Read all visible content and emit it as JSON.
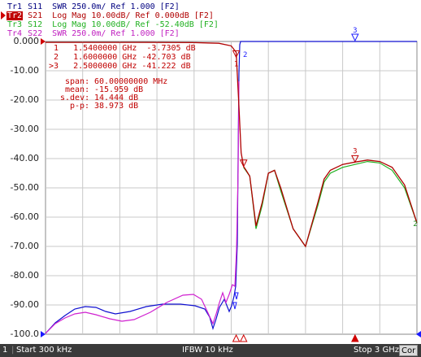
{
  "traces": [
    {
      "name": "Tr1",
      "text": " S11  SWR 250.0m/ Ref 1.000 [F2]",
      "color": "#000080",
      "active": false
    },
    {
      "name": "Tr2",
      "text": " S21  Log Mag 10.00dB/ Ref 0.000dB [F2]",
      "color": "#b00000",
      "active": true
    },
    {
      "name": "Tr3",
      "text": " S12  Log Mag 10.00dB/ Ref -52.40dB [F2]",
      "color": "#20b020",
      "active": false
    },
    {
      "name": "Tr4",
      "text": " S22  SWR 250.0m/ Ref 1.000 [F2]",
      "color": "#c020c0",
      "active": false
    }
  ],
  "y_axis_labels": [
    "0.000",
    "-10.00",
    "-20.00",
    "-30.00",
    "-40.00",
    "-50.00",
    "-60.00",
    "-70.00",
    "-80.00",
    "-90.00",
    "-100.0"
  ],
  "markers": [
    {
      "label": " 1   1.5400000 GHz  -3.7305 dB"
    },
    {
      "label": " 2   1.6000000 GHz -42.703 dB"
    },
    {
      "label": ">3   2.5000000 GHz -41.222 dB"
    }
  ],
  "stats": [
    {
      "label": "span:",
      "value": "60.00000000 MHz"
    },
    {
      "label": "mean:",
      "value": "-15.959 dB"
    },
    {
      "label": "s.dev:",
      "value": "14.444 dB"
    },
    {
      "label": "p-p:",
      "value": "38.973 dB"
    }
  ],
  "marker_tags": {
    "m1": "1",
    "m2": "2",
    "m3": "3",
    "top_m3": "3",
    "right_ref": "2"
  },
  "status": {
    "channel": "1",
    "start": "Start 300 kHz",
    "ifbw": "IFBW 10 kHz",
    "stop": "Stop 3 GHz",
    "cor": "Cor"
  },
  "colors": {
    "s21": "#b00000",
    "s12": "#20b020",
    "s11": "#1010d0",
    "s22": "#d020d0",
    "grid": "#c8c8c8",
    "marker": "#c00000"
  },
  "chart_data": {
    "type": "line",
    "xlabel": "",
    "ylabel": "",
    "x_range": [
      "300 kHz",
      "3 GHz"
    ],
    "x_unit": "GHz",
    "ylim": [
      -100,
      0
    ],
    "grid": true,
    "series": [
      {
        "name": "S21",
        "x": [
          0.0003,
          0.3,
          0.8,
          1.2,
          1.4,
          1.5,
          1.54,
          1.56,
          1.58,
          1.6,
          1.62,
          1.65,
          1.7,
          1.75,
          1.8,
          1.85,
          1.9,
          2.0,
          2.1,
          2.2,
          2.25,
          2.3,
          2.4,
          2.5,
          2.6,
          2.7,
          2.8,
          2.9,
          3.0
        ],
        "values": [
          -0.3,
          -0.3,
          -0.3,
          -0.4,
          -0.6,
          -1.5,
          -3.7,
          -20,
          -38,
          -42.7,
          -44,
          -46,
          -63,
          -55,
          -45,
          -44,
          -50,
          -64,
          -70,
          -55,
          -47,
          -44,
          -42,
          -41.2,
          -40.5,
          -41,
          -43,
          -49,
          -62
        ]
      },
      {
        "name": "S12",
        "x": [
          1.6,
          1.65,
          1.7,
          1.75,
          1.8,
          1.85,
          1.9,
          2.0,
          2.1,
          2.2,
          2.25,
          2.3,
          2.4,
          2.5,
          2.6,
          2.7,
          2.8,
          2.9,
          3.0
        ],
        "values": [
          -43,
          -46,
          -64,
          -56,
          -45,
          -44,
          -51,
          -64,
          -70,
          -56,
          -48,
          -45,
          -43,
          -42,
          -41,
          -41.5,
          -44,
          -50,
          -62
        ]
      }
    ]
  }
}
